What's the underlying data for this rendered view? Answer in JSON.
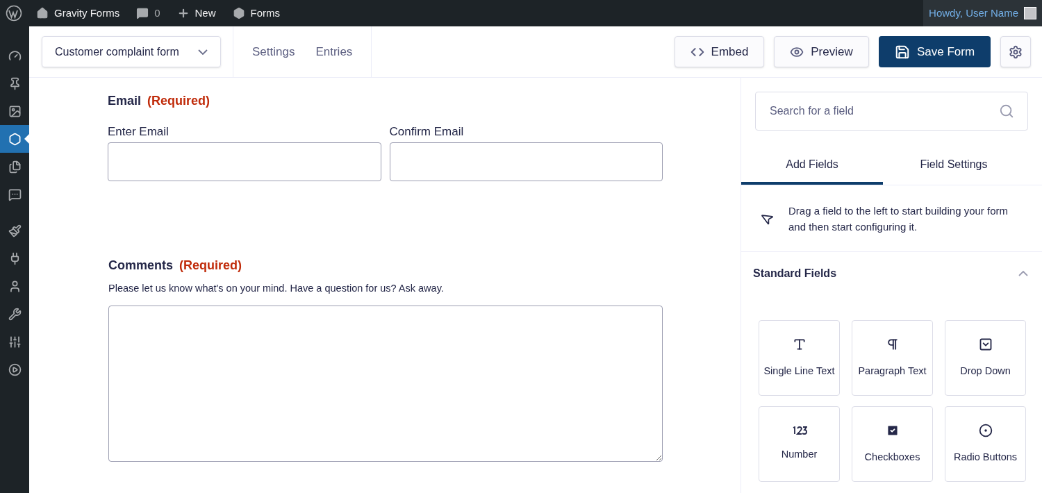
{
  "admin_bar": {
    "items": [
      {
        "kind": "site",
        "label": "Gravity Forms"
      },
      {
        "kind": "comments",
        "label": "0"
      },
      {
        "kind": "new",
        "label": "New"
      },
      {
        "kind": "forms",
        "label": "Forms"
      }
    ],
    "account": "Howdy, User Name"
  },
  "sidebar": {
    "items": [
      {
        "kind": "dashboard",
        "selected": false
      },
      {
        "kind": "posts",
        "selected": false
      },
      {
        "kind": "media",
        "selected": false
      },
      {
        "kind": "forms",
        "selected": true
      },
      {
        "kind": "pages",
        "selected": false
      },
      {
        "kind": "comments",
        "selected": false
      },
      {
        "kind": "appearance",
        "selected": false
      },
      {
        "kind": "plugins",
        "selected": false
      },
      {
        "kind": "users",
        "selected": false
      },
      {
        "kind": "tools",
        "selected": false
      },
      {
        "kind": "settings",
        "selected": false
      },
      {
        "kind": "media-play",
        "selected": false
      }
    ]
  },
  "toolbar": {
    "form_select": "Customer complaint form",
    "links": [
      "Settings",
      "Entries"
    ],
    "buttons": [
      {
        "kind": "embed",
        "label": "Embed"
      },
      {
        "kind": "preview",
        "label": "Preview"
      },
      {
        "kind": "save",
        "label": "Save Form"
      }
    ]
  },
  "form": {
    "email": {
      "label": "Email",
      "required": "(Required)",
      "subfields": [
        "Enter Email",
        "Confirm Email"
      ]
    },
    "comments": {
      "label": "Comments",
      "required": "(Required)",
      "description": "Please let us know what's on your mind. Have a question for us? Ask away."
    }
  },
  "panel": {
    "search": {
      "placeholder": "Search for a field"
    },
    "tabs": [
      {
        "label": "Add Fields",
        "selected": true
      },
      {
        "label": "Field Settings",
        "selected": false
      }
    ],
    "hint": "Drag a field to the left to start building your form and then start configuring it.",
    "section": {
      "title": "Standard Fields",
      "expanded": true
    },
    "fields": [
      {
        "kind": "text",
        "label": "Single Line Text"
      },
      {
        "kind": "paragraph",
        "label": "Paragraph Text"
      },
      {
        "kind": "dropdown",
        "label": "Drop Down"
      },
      {
        "kind": "number",
        "label": "Number"
      },
      {
        "kind": "checkbox",
        "label": "Checkboxes"
      },
      {
        "kind": "radio",
        "label": "Radio Buttons"
      }
    ]
  }
}
